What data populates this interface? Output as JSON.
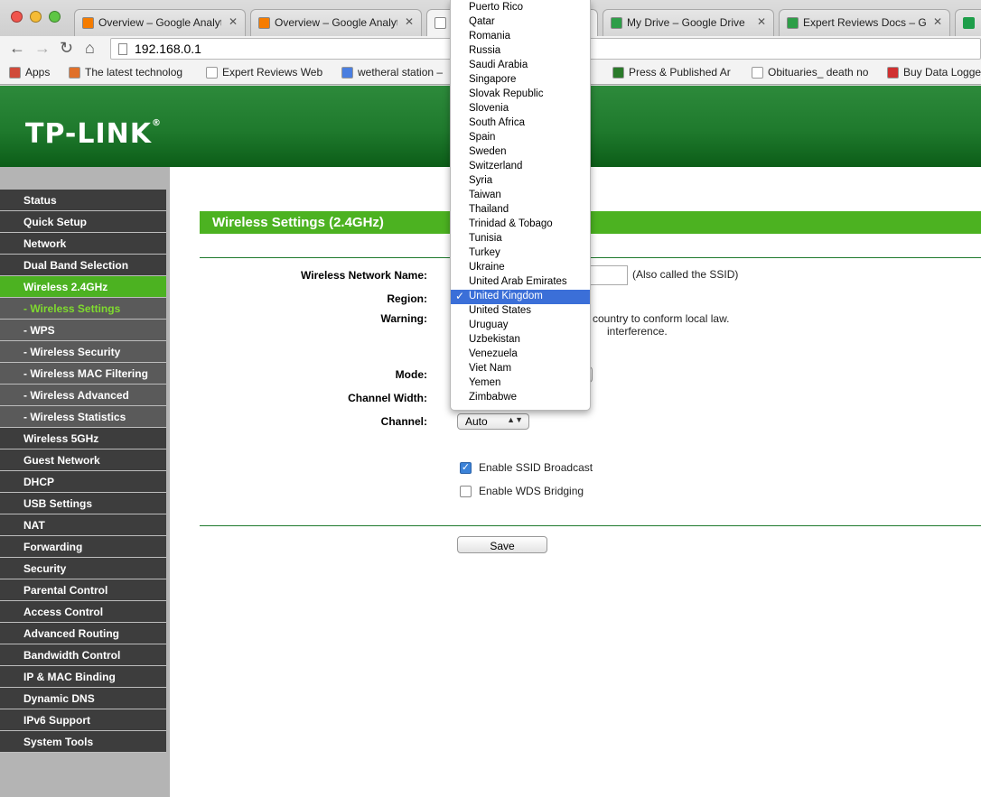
{
  "browser": {
    "tabs": [
      {
        "title": "Overview – Google Analytic",
        "icon": "analytics-icon",
        "color": "#f57c00"
      },
      {
        "title": "Overview – Google Analytic",
        "icon": "analytics-icon",
        "color": "#f57c00"
      },
      {
        "title": "",
        "icon": "page-icon",
        "color": "#ffffff"
      },
      {
        "title": "My Drive – Google Drive",
        "icon": "drive-icon",
        "color": "#2e9e48"
      },
      {
        "title": "Expert Reviews Docs – Goo",
        "icon": "drive-icon",
        "color": "#2e9e48"
      }
    ],
    "url": "192.168.0.1",
    "bookmarks": [
      {
        "label": "Apps",
        "icon": "apps-grid-icon"
      },
      {
        "label": "The latest technolog",
        "icon": "bookmark-site-icon"
      },
      {
        "label": "Expert Reviews Web",
        "icon": "page-icon"
      },
      {
        "label": "wetheral station –",
        "icon": "google-icon"
      },
      {
        "label": "Press & Published Ar",
        "icon": "site-icon"
      },
      {
        "label": "Obituaries_ death no",
        "icon": "page-icon"
      },
      {
        "label": "Buy Data Logge",
        "icon": "site-icon"
      }
    ]
  },
  "brand": {
    "logo": "TP-LINK",
    "reg": "®"
  },
  "menu": [
    {
      "label": "Status",
      "type": "main"
    },
    {
      "label": "Quick Setup",
      "type": "main"
    },
    {
      "label": "Network",
      "type": "main"
    },
    {
      "label": "Dual Band Selection",
      "type": "main"
    },
    {
      "label": "Wireless 2.4GHz",
      "type": "main-active"
    },
    {
      "label": "- Wireless Settings",
      "type": "sub-active"
    },
    {
      "label": "- WPS",
      "type": "sub"
    },
    {
      "label": "- Wireless Security",
      "type": "sub"
    },
    {
      "label": "- Wireless MAC Filtering",
      "type": "sub"
    },
    {
      "label": "- Wireless Advanced",
      "type": "sub"
    },
    {
      "label": "- Wireless Statistics",
      "type": "sub"
    },
    {
      "label": "Wireless 5GHz",
      "type": "main"
    },
    {
      "label": "Guest Network",
      "type": "main"
    },
    {
      "label": "DHCP",
      "type": "main"
    },
    {
      "label": "USB Settings",
      "type": "main"
    },
    {
      "label": "NAT",
      "type": "main"
    },
    {
      "label": "Forwarding",
      "type": "main"
    },
    {
      "label": "Security",
      "type": "main"
    },
    {
      "label": "Parental Control",
      "type": "main"
    },
    {
      "label": "Access Control",
      "type": "main"
    },
    {
      "label": "Advanced Routing",
      "type": "main"
    },
    {
      "label": "Bandwidth Control",
      "type": "main"
    },
    {
      "label": "IP & MAC Binding",
      "type": "main"
    },
    {
      "label": "Dynamic DNS",
      "type": "main"
    },
    {
      "label": "IPv6 Support",
      "type": "main"
    },
    {
      "label": "System Tools",
      "type": "main"
    }
  ],
  "page": {
    "title": "Wireless Settings (2.4GHz)",
    "labels": {
      "ssid": "Wireless Network Name:",
      "region": "Region:",
      "warning": "Warning:",
      "mode": "Mode:",
      "channel_width": "Channel Width:",
      "channel": "Channel:"
    },
    "ssid_value": "",
    "ssid_note": "(Also called the SSID)",
    "warning_line1": "country to conform local law.",
    "warning_line2": "interference.",
    "channel_value": "Auto",
    "checkboxes": {
      "ssid_broadcast": {
        "label": "Enable SSID Broadcast",
        "checked": true
      },
      "wds_bridging": {
        "label": "Enable WDS Bridging",
        "checked": false
      }
    },
    "save_label": "Save"
  },
  "region_dropdown": {
    "selected": "United Kingdom",
    "options": [
      "Puerto Rico",
      "Qatar",
      "Romania",
      "Russia",
      "Saudi Arabia",
      "Singapore",
      "Slovak Republic",
      "Slovenia",
      "South Africa",
      "Spain",
      "Sweden",
      "Switzerland",
      "Syria",
      "Taiwan",
      "Thailand",
      "Trinidad & Tobago",
      "Tunisia",
      "Turkey",
      "Ukraine",
      "United Arab Emirates",
      "United Kingdom",
      "United States",
      "Uruguay",
      "Uzbekistan",
      "Venezuela",
      "Viet Nam",
      "Yemen",
      "Zimbabwe"
    ]
  },
  "colors": {
    "brand_green": "#1f7a2d",
    "accent_green": "#4cb221",
    "menu_dark": "#3d3d3d",
    "selection_blue": "#3b6fd8"
  }
}
